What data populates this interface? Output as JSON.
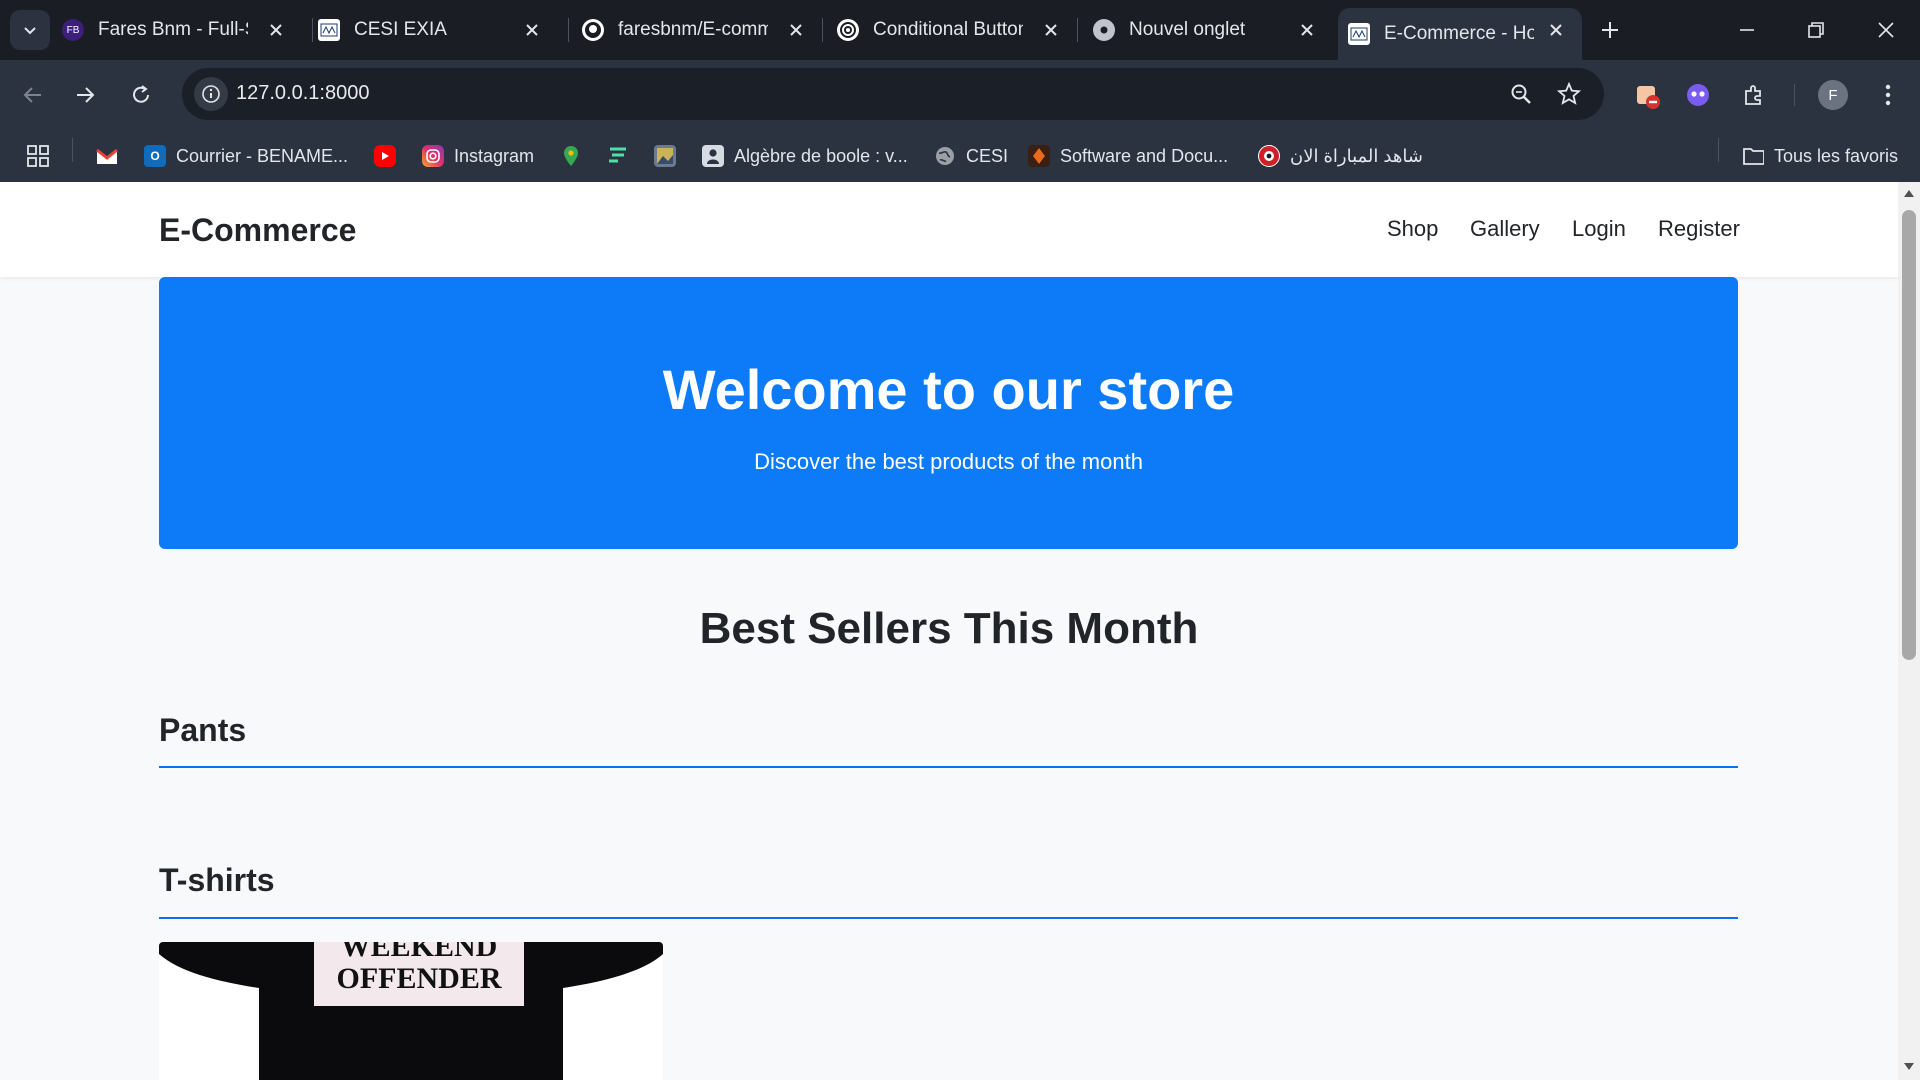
{
  "browser": {
    "tabs": [
      {
        "title": "Fares Bnm - Full-St",
        "icon": "fb-logo-icon",
        "color": "#3b1f7a"
      },
      {
        "title": "CESI EXIA",
        "icon": "cesi-icon",
        "color": "#ffffff"
      },
      {
        "title": "faresbnm/E-comm",
        "icon": "github-icon",
        "color": "#ffffff"
      },
      {
        "title": "Conditional Button",
        "icon": "openai-icon",
        "color": "#ffffff"
      },
      {
        "title": "Nouvel onglet",
        "icon": "chrome-icon",
        "color": "#ffffff"
      },
      {
        "title": "E-Commerce - Hor",
        "icon": "cesi-icon",
        "color": "#ffffff",
        "active": true
      }
    ],
    "url": "127.0.0.1:8000",
    "bookmarks": [
      {
        "label": "",
        "icon": "gmail-icon"
      },
      {
        "label": "Courrier - BENAME...",
        "icon": "outlook-icon"
      },
      {
        "label": "",
        "icon": "youtube-icon"
      },
      {
        "label": "Instagram",
        "icon": "instagram-icon"
      },
      {
        "label": "",
        "icon": "maps-icon"
      },
      {
        "label": "",
        "icon": "frame-icon"
      },
      {
        "label": "",
        "icon": "photo-icon"
      },
      {
        "label": "Algèbre de boole : v...",
        "icon": "doc-icon"
      },
      {
        "label": "CESI",
        "icon": "globe-icon"
      },
      {
        "label": "Software and Docu...",
        "icon": "software-icon"
      },
      {
        "label": "شاهد المباراة الان",
        "icon": "soccer-icon"
      }
    ],
    "all_bookmarks": "Tous les favoris",
    "profile_initial": "F",
    "accent": "#0d7bf7"
  },
  "site": {
    "brand": "E-Commerce",
    "nav": [
      "Shop",
      "Gallery",
      "Login",
      "Register"
    ],
    "hero_title": "Welcome to our store",
    "hero_subtitle": "Discover the best products of the month",
    "section_title": "Best Sellers This Month",
    "categories": [
      "Pants",
      "T-shirts"
    ],
    "product_print": [
      "WEEKEND",
      "OFFENDER"
    ]
  }
}
